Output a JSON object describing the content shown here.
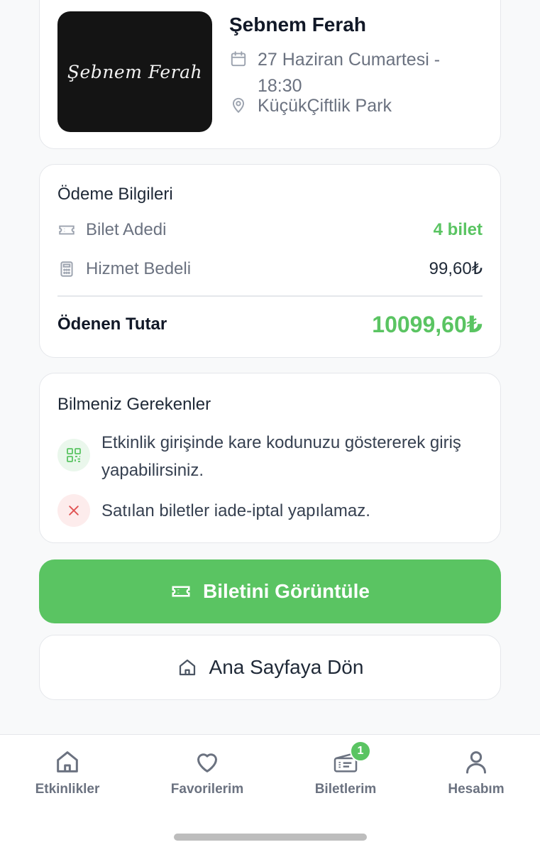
{
  "event": {
    "image_text": "Şebnem Ferah",
    "title": "Şebnem Ferah",
    "date": "27 Haziran Cumartesi - 18:30",
    "venue": "KüçükÇiftlik Park"
  },
  "payment": {
    "title": "Ödeme Bilgileri",
    "ticket_count_label": "Bilet Adedi",
    "ticket_count_value": "4 bilet",
    "service_fee_label": "Hizmet Bedeli",
    "service_fee_value": "99,60₺",
    "total_label": "Ödenen Tutar",
    "total_value": "10099,60₺"
  },
  "info": {
    "title": "Bilmeniz Gerekenler",
    "qr_text": "Etkinlik girişinde kare kodunuzu göstererek giriş yapabilirsiniz.",
    "refund_text": "Satılan biletler iade-iptal yapılamaz."
  },
  "buttons": {
    "view_ticket": "Biletini Görüntüle",
    "home": "Ana Sayfaya Dön"
  },
  "tabbar": {
    "events": "Etkinlikler",
    "favorites": "Favorilerim",
    "tickets": "Biletlerim",
    "tickets_badge": "1",
    "account": "Hesabım"
  },
  "colors": {
    "accent_green": "#5ac462",
    "error_red": "#e05252",
    "muted_text": "#6b7280"
  },
  "icons": {
    "date": "calendar-icon",
    "venue": "location-pin-icon",
    "tickets": "ticket-icon",
    "fee": "calculator-icon",
    "qr": "qr-code-icon",
    "refund": "close-icon",
    "home": "home-icon",
    "favorites": "heart-icon",
    "account": "user-icon"
  }
}
